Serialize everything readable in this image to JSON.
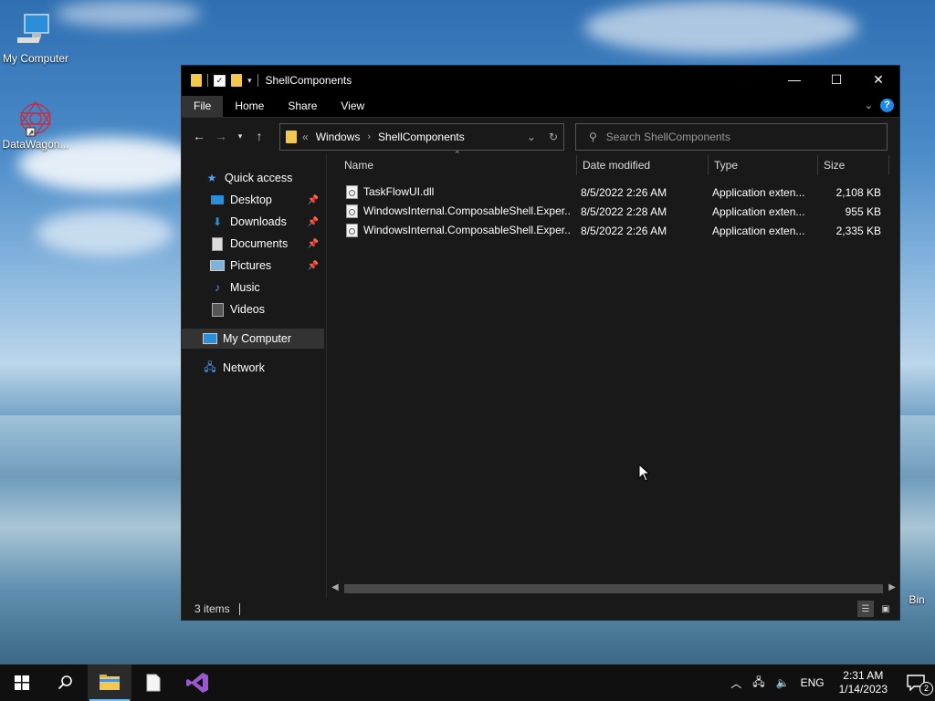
{
  "desktop": {
    "icons": [
      {
        "label": "My Computer"
      },
      {
        "label": "DataWagon..."
      },
      {
        "label": "Bin"
      }
    ]
  },
  "window": {
    "title": "ShellComponents",
    "controls": {
      "minimize": "—",
      "maximize": "☐",
      "close": "✕"
    },
    "ribbon_tabs": [
      "File",
      "Home",
      "Share",
      "View"
    ],
    "address": {
      "overflow": "«",
      "segments": [
        "Windows",
        "ShellComponents"
      ]
    },
    "search_placeholder": "Search ShellComponents",
    "nav_pane": {
      "quick_access": "Quick access",
      "items": [
        {
          "label": "Desktop",
          "pinned": true,
          "icon": "desktop-icon"
        },
        {
          "label": "Downloads",
          "pinned": true,
          "icon": "downloads-icon"
        },
        {
          "label": "Documents",
          "pinned": true,
          "icon": "documents-icon"
        },
        {
          "label": "Pictures",
          "pinned": true,
          "icon": "pictures-icon"
        },
        {
          "label": "Music",
          "pinned": false,
          "icon": "music-icon"
        },
        {
          "label": "Videos",
          "pinned": false,
          "icon": "videos-icon"
        }
      ],
      "my_computer": "My Computer",
      "network": "Network"
    },
    "columns": {
      "name": "Name",
      "date": "Date modified",
      "type": "Type",
      "size": "Size"
    },
    "files": [
      {
        "name": "TaskFlowUI.dll",
        "date": "8/5/2022 2:26 AM",
        "type": "Application exten...",
        "size": "2,108 KB"
      },
      {
        "name": "WindowsInternal.ComposableShell.Exper...",
        "date": "8/5/2022 2:28 AM",
        "type": "Application exten...",
        "size": "955 KB"
      },
      {
        "name": "WindowsInternal.ComposableShell.Exper...",
        "date": "8/5/2022 2:26 AM",
        "type": "Application exten...",
        "size": "2,335 KB"
      }
    ],
    "status": {
      "items": "3 items"
    }
  },
  "taskbar": {
    "tray_lang": "ENG",
    "time": "2:31 AM",
    "date": "1/14/2023",
    "notification_count": "2"
  }
}
